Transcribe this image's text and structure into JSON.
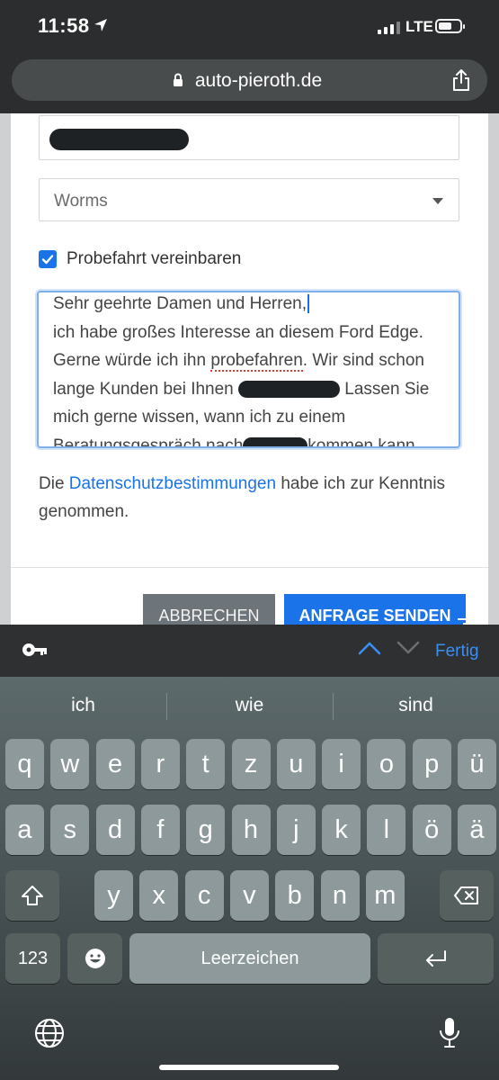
{
  "status_bar": {
    "time": "11:58",
    "network": "LTE"
  },
  "browser": {
    "url": "auto-pieroth.de"
  },
  "form": {
    "city_value": "Worms",
    "checkbox_label": "Probefahrt vereinbaren",
    "checkbox_checked": true,
    "message_lines": [
      "Sehr geehrte Damen und Herren,",
      "ich habe großes Interesse an diesem Ford Edge.",
      "Gerne würde ich ihn probefahren. Wir sind schon",
      "lange Kunden bei Ihnen",
      "Lassen Sie",
      "mich gerne wissen, wann ich zu einem",
      "Beratungsgespräch nach",
      "kommen kann."
    ],
    "privacy_prefix": "Die ",
    "privacy_link": "Datenschutzbestimmungen",
    "privacy_suffix": " habe ich zur Kenntnis genommen.",
    "cancel_label": "ABBRECHEN",
    "send_label": "ANFRAGE SENDEN"
  },
  "keyboard_accessory": {
    "done_label": "Fertig"
  },
  "keyboard": {
    "suggestions": [
      "ich",
      "wie",
      "sind"
    ],
    "row1": [
      "q",
      "w",
      "e",
      "r",
      "t",
      "z",
      "u",
      "i",
      "o",
      "p",
      "ü"
    ],
    "row2": [
      "a",
      "s",
      "d",
      "f",
      "g",
      "h",
      "j",
      "k",
      "l",
      "ö",
      "ä"
    ],
    "row3": [
      "y",
      "x",
      "c",
      "v",
      "b",
      "n",
      "m"
    ],
    "numbers_label": "123",
    "space_label": "Leerzeichen"
  }
}
